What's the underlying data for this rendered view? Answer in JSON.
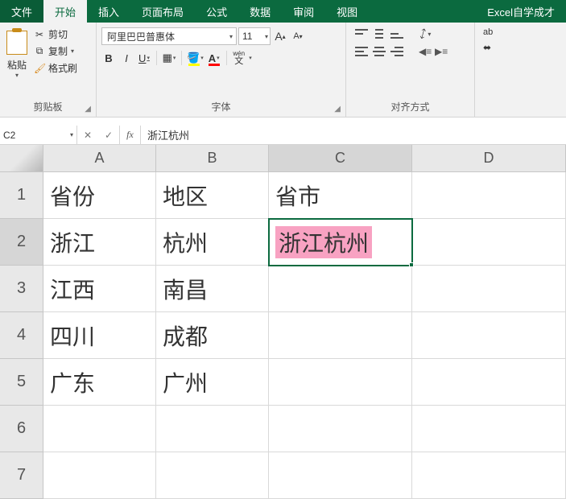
{
  "menu": {
    "file": "文件",
    "tabs": [
      "开始",
      "插入",
      "页面布局",
      "公式",
      "数据",
      "审阅",
      "视图"
    ],
    "active_tab_index": 0,
    "right": "Excel自学成才"
  },
  "ribbon": {
    "clipboard": {
      "paste": "粘贴",
      "cut": "剪切",
      "copy": "复制",
      "format_painter": "格式刷",
      "label": "剪贴板"
    },
    "font": {
      "family": "阿里巴巴普惠体",
      "size": "11",
      "label": "字体",
      "bold": "B",
      "italic": "I",
      "underline": "U",
      "pinyin": "wén"
    },
    "align": {
      "label": "对齐方式",
      "wrap": "ab"
    }
  },
  "formula_bar": {
    "cell_ref": "C2",
    "formula": "浙江杭州"
  },
  "grid": {
    "columns": [
      "A",
      "B",
      "C",
      "D"
    ],
    "active_col_index": 2,
    "rows": [
      {
        "num": "1",
        "cells": [
          "省份",
          "地区",
          "省市",
          ""
        ]
      },
      {
        "num": "2",
        "cells": [
          "浙江",
          "杭州",
          "浙江杭州",
          ""
        ]
      },
      {
        "num": "3",
        "cells": [
          "江西",
          "南昌",
          "",
          ""
        ]
      },
      {
        "num": "4",
        "cells": [
          "四川",
          "成都",
          "",
          ""
        ]
      },
      {
        "num": "5",
        "cells": [
          "广东",
          "广州",
          "",
          ""
        ]
      },
      {
        "num": "6",
        "cells": [
          "",
          "",
          "",
          ""
        ]
      },
      {
        "num": "7",
        "cells": [
          "",
          "",
          "",
          ""
        ]
      }
    ],
    "active_row_index": 1,
    "active": {
      "row": 1,
      "col": 2
    }
  }
}
